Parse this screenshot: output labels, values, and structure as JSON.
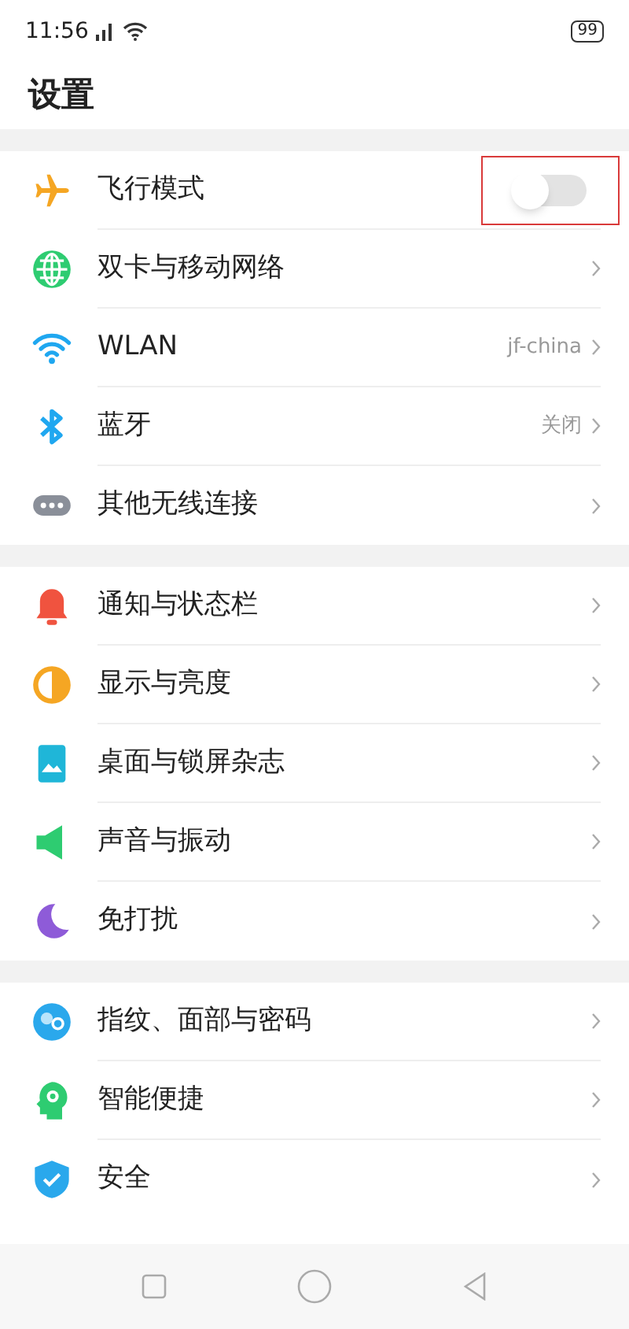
{
  "status_bar": {
    "time": "11:56",
    "battery": "99"
  },
  "title": "设置",
  "groups": [
    {
      "items": [
        {
          "kind": "toggle",
          "label": "飞行模式",
          "on": false,
          "highlighted": true
        },
        {
          "kind": "link",
          "label": "双卡与移动网络"
        },
        {
          "kind": "link",
          "label": "WLAN",
          "value": "jf-china"
        },
        {
          "kind": "link",
          "label": "蓝牙",
          "value": "关闭"
        },
        {
          "kind": "link",
          "label": "其他无线连接"
        }
      ]
    },
    {
      "items": [
        {
          "kind": "link",
          "label": "通知与状态栏"
        },
        {
          "kind": "link",
          "label": "显示与亮度"
        },
        {
          "kind": "link",
          "label": "桌面与锁屏杂志"
        },
        {
          "kind": "link",
          "label": "声音与振动"
        },
        {
          "kind": "link",
          "label": "免打扰"
        }
      ]
    },
    {
      "items": [
        {
          "kind": "link",
          "label": "指纹、面部与密码"
        },
        {
          "kind": "link",
          "label": "智能便捷"
        },
        {
          "kind": "link",
          "label": "安全"
        }
      ]
    }
  ]
}
